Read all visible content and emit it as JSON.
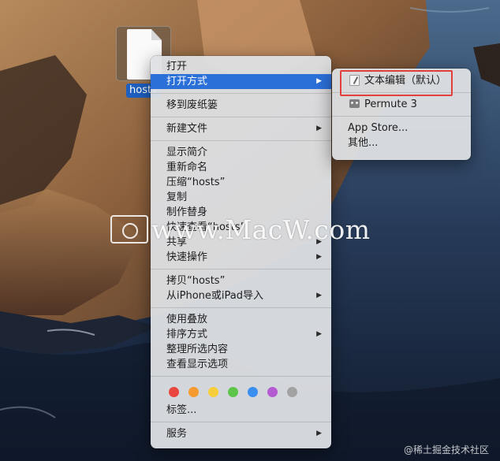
{
  "desktop": {
    "file": {
      "name": "hosts"
    }
  },
  "context_menu": {
    "groups": [
      [
        {
          "label": "打开",
          "submenu": false,
          "highlighted": false
        },
        {
          "label": "打开方式",
          "submenu": true,
          "highlighted": true
        }
      ],
      [
        {
          "label": "移到废纸篓",
          "submenu": false,
          "highlighted": false
        }
      ],
      [
        {
          "label": "新建文件",
          "submenu": true,
          "highlighted": false
        }
      ],
      [
        {
          "label": "显示简介",
          "submenu": false,
          "highlighted": false
        },
        {
          "label": "重新命名",
          "submenu": false,
          "highlighted": false
        },
        {
          "label": "压缩“hosts”",
          "submenu": false,
          "highlighted": false
        },
        {
          "label": "复制",
          "submenu": false,
          "highlighted": false
        },
        {
          "label": "制作替身",
          "submenu": false,
          "highlighted": false
        },
        {
          "label": "快速查看“hosts”",
          "submenu": false,
          "highlighted": false
        },
        {
          "label": "共享",
          "submenu": true,
          "highlighted": false
        },
        {
          "label": "快速操作",
          "submenu": true,
          "highlighted": false
        }
      ],
      [
        {
          "label": "拷贝“hosts”",
          "submenu": false,
          "highlighted": false
        },
        {
          "label": "从iPhone或iPad导入",
          "submenu": true,
          "highlighted": false
        }
      ],
      [
        {
          "label": "使用叠放",
          "submenu": false,
          "highlighted": false
        },
        {
          "label": "排序方式",
          "submenu": true,
          "highlighted": false
        },
        {
          "label": "整理所选内容",
          "submenu": false,
          "highlighted": false
        },
        {
          "label": "查看显示选项",
          "submenu": false,
          "highlighted": false
        }
      ]
    ],
    "tag_colors": [
      "#e8463f",
      "#f49a2e",
      "#f6ce3b",
      "#5dc64a",
      "#3a8ef0",
      "#b45bd2",
      "#a2a2a2"
    ],
    "tags_label": "标签...",
    "services_label": "服务",
    "arrow_icon": "▶"
  },
  "open_with_submenu": {
    "default_app": {
      "label": "文本编辑（默认）",
      "icon": "textedit-icon"
    },
    "apps": [
      {
        "label": "Permute 3",
        "icon": "permute-icon"
      }
    ],
    "extra": [
      "App Store...",
      "其他..."
    ]
  },
  "overlay": {
    "watermark": "www.MacW.com",
    "credit": "@稀土掘金技术社区"
  },
  "colors": {
    "menu_highlight": "#2b6fd8",
    "annotation_box": "#e3403c",
    "file_selection": "#1f5fbf"
  }
}
